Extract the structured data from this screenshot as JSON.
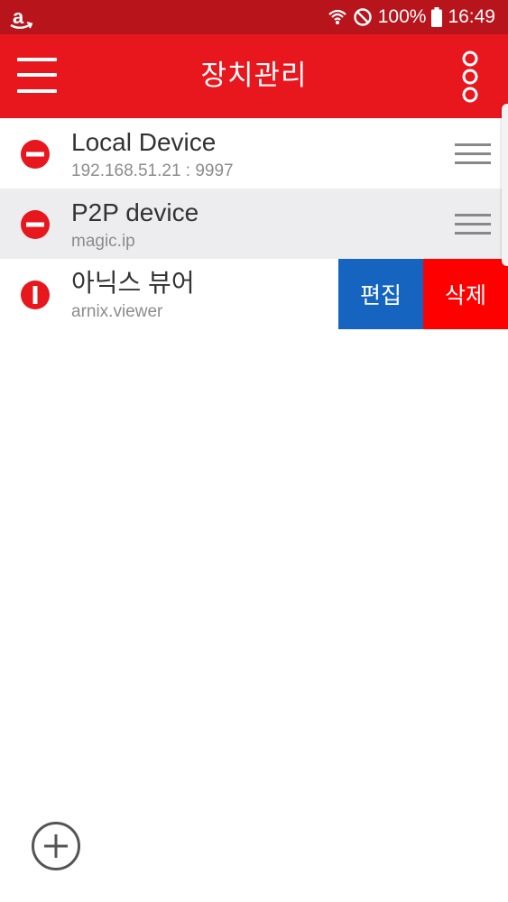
{
  "status_bar": {
    "app_icon": "amazon-icon",
    "battery": "100%",
    "time": "16:49",
    "icons": [
      "wifi-icon",
      "do-not-disturb-icon",
      "battery-icon"
    ]
  },
  "toolbar": {
    "title": "장치관리",
    "menu_icon": "hamburger-menu-icon",
    "more_icon": "more-vertical-icon"
  },
  "devices": [
    {
      "name": "Local Device",
      "address": "192.168.51.21 : 9997",
      "icon": "remove-circle-icon"
    },
    {
      "name": "P2P device",
      "address": "magic.ip",
      "icon": "remove-circle-icon"
    },
    {
      "name": "아닉스 뷰어",
      "address": "arnix.viewer",
      "icon": "remove-circle-rotated-icon"
    }
  ],
  "swipe_actions": {
    "edit_label": "편집",
    "delete_label": "삭제"
  },
  "fab": {
    "icon": "add-circle-icon"
  },
  "colors": {
    "status_bar": "#b7141c",
    "toolbar": "#e8161d",
    "edit": "#1565c0",
    "delete": "#ff0000",
    "remove_icon": "#e8161d"
  }
}
